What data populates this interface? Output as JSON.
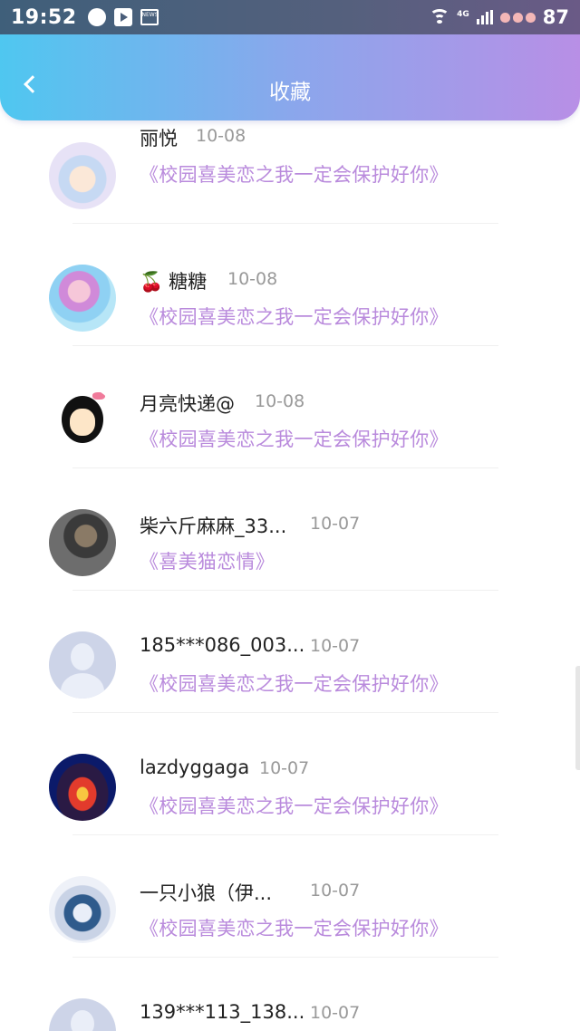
{
  "status_bar": {
    "time": "19:52",
    "network": "4G",
    "battery": "87",
    "icons": [
      "notification-dot-icon",
      "play-icon",
      "news-icon",
      "wifi-icon",
      "signal-icon",
      "battery-icon"
    ]
  },
  "header": {
    "title": "收藏",
    "back_icon": "chevron-left-icon",
    "gradient": [
      "#4fc7f0",
      "#b88fe6"
    ]
  },
  "colors": {
    "book_title": "#b98adc",
    "date": "#999999",
    "name": "#222222"
  },
  "favorites": [
    {
      "name": "丽悦",
      "date": "10-08",
      "book": "《校园喜美恋之我一定会保护好你》",
      "avatar": "anime-girl-avatar"
    },
    {
      "emoji": "🍒",
      "name": "糖糖",
      "date": "10-08",
      "book": "《校园喜美恋之我一定会保护好你》",
      "avatar": "pink-girl-avatar"
    },
    {
      "name": "月亮快递@",
      "date": "10-08",
      "book": "《校园喜美恋之我一定会保护好你》",
      "avatar": "cartoon-face-avatar"
    },
    {
      "name": "柴六斤麻麻_33...",
      "date": "10-07",
      "book": "《喜美猫恋情》",
      "avatar": "dog-avatar"
    },
    {
      "name": "185***086_003...",
      "date": "10-07",
      "book": "《校园喜美恋之我一定会保护好你》",
      "avatar": "default-user-avatar"
    },
    {
      "name": "lazdyggaga",
      "date": "10-07",
      "book": "《校园喜美恋之我一定会保护好你》",
      "avatar": "car-avatar"
    },
    {
      "name": "一只小狼（伊...",
      "date": "10-07",
      "book": "《校园喜美恋之我一定会保护好你》",
      "avatar": "wolf-girl-avatar"
    },
    {
      "name": "139***113_138...",
      "date": "10-07",
      "book": "",
      "avatar": "default-user-avatar"
    }
  ]
}
